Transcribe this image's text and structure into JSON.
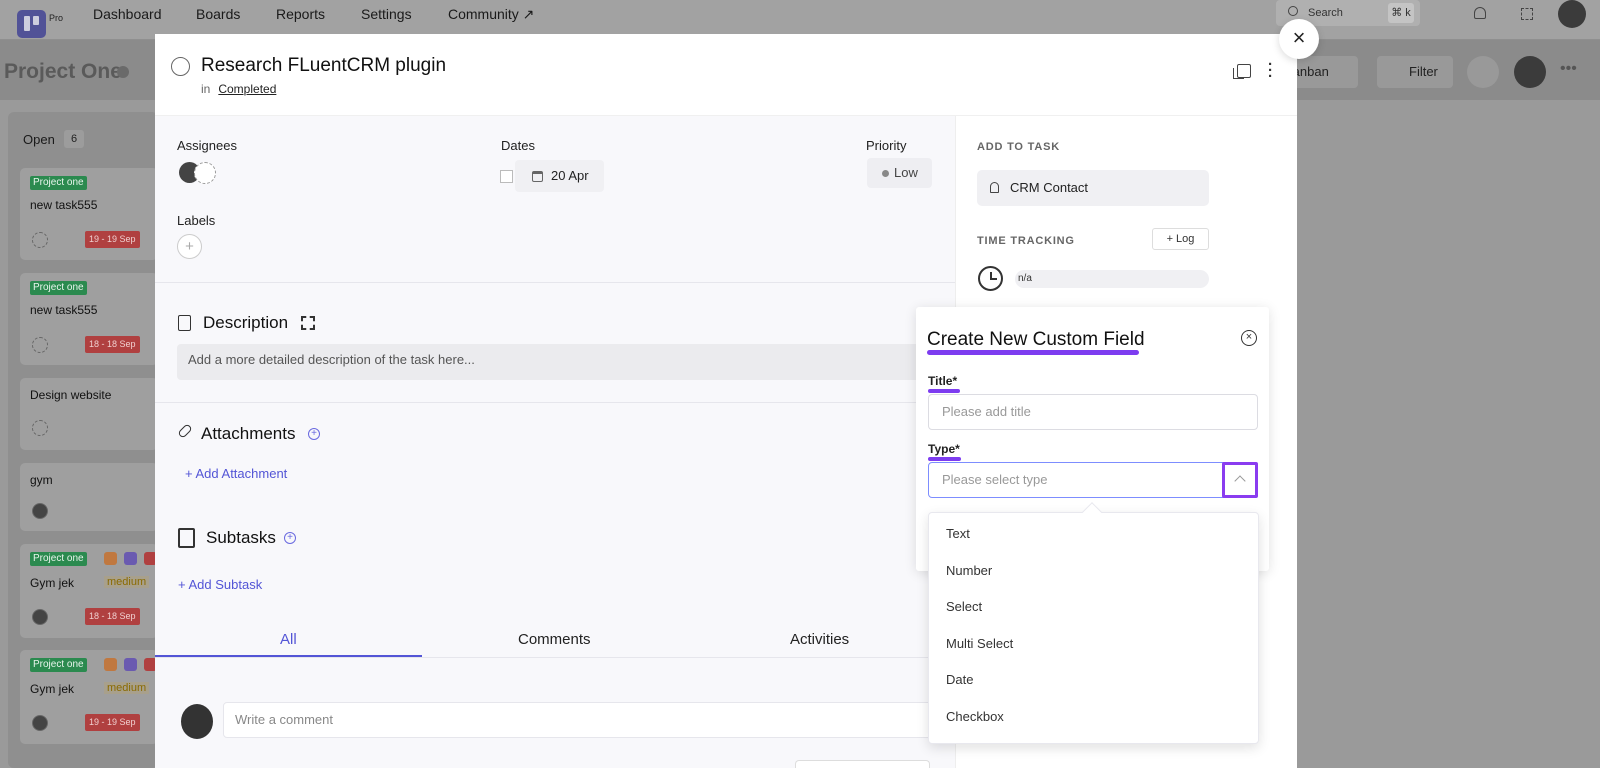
{
  "topnav": {
    "logo_badge": "Pro",
    "links": [
      "Dashboard",
      "Boards",
      "Reports",
      "Settings",
      "Community ↗"
    ],
    "search_placeholder": "Search",
    "search_shortcut": "⌘ k"
  },
  "project": {
    "title": "Project One",
    "view": "Kanban",
    "filter_label": "Filter"
  },
  "board": {
    "column_name": "Open",
    "column_count": "6",
    "cards": [
      {
        "tag": "Project one",
        "title": "new task555",
        "date": "19 - 19 Sep"
      },
      {
        "tag": "Project one",
        "title": "new task555",
        "date": "18 - 18 Sep"
      },
      {
        "tag": "",
        "title": "Design website",
        "date": ""
      },
      {
        "tag": "",
        "title": "gym",
        "date": ""
      },
      {
        "tag": "Project one",
        "title": "Gym jek",
        "priority": "medium",
        "date": "18 - 18 Sep"
      },
      {
        "tag": "Project one",
        "title": "Gym jek",
        "priority": "medium",
        "date": "19 - 19 Sep"
      }
    ]
  },
  "task": {
    "title": "Research FLuentCRM plugin",
    "in_label": "in",
    "stage": "Completed",
    "assignees_label": "Assignees",
    "dates_label": "Dates",
    "date_value": "20 Apr",
    "priority_label": "Priority",
    "priority_value": "Low",
    "labels_label": "Labels",
    "description_heading": "Description",
    "description_placeholder": "Add a more detailed description of the task here...",
    "attachments_heading": "Attachments",
    "add_attachment": "Add Attachment",
    "subtasks_heading": "Subtasks",
    "add_subtask": "Add Subtask",
    "tabs": [
      "All",
      "Comments",
      "Activities"
    ],
    "comment_placeholder": "Write a comment"
  },
  "sidebar": {
    "add_to_task": "ADD TO TASK",
    "crm_contact": "CRM Contact",
    "time_tracking": "TIME TRACKING",
    "log_label": "+ Log",
    "time_value": "n/a"
  },
  "custom_field": {
    "heading": "Create New Custom Field",
    "title_label": "Title*",
    "title_placeholder": "Please add title",
    "type_label": "Type*",
    "type_placeholder": "Please select type",
    "type_options": [
      "Text",
      "Number",
      "Select",
      "Multi Select",
      "Date",
      "Checkbox"
    ]
  },
  "colors": {
    "accent": "#5355d6",
    "highlight": "#7d3cf0",
    "tag_green": "#2b8a4f"
  }
}
